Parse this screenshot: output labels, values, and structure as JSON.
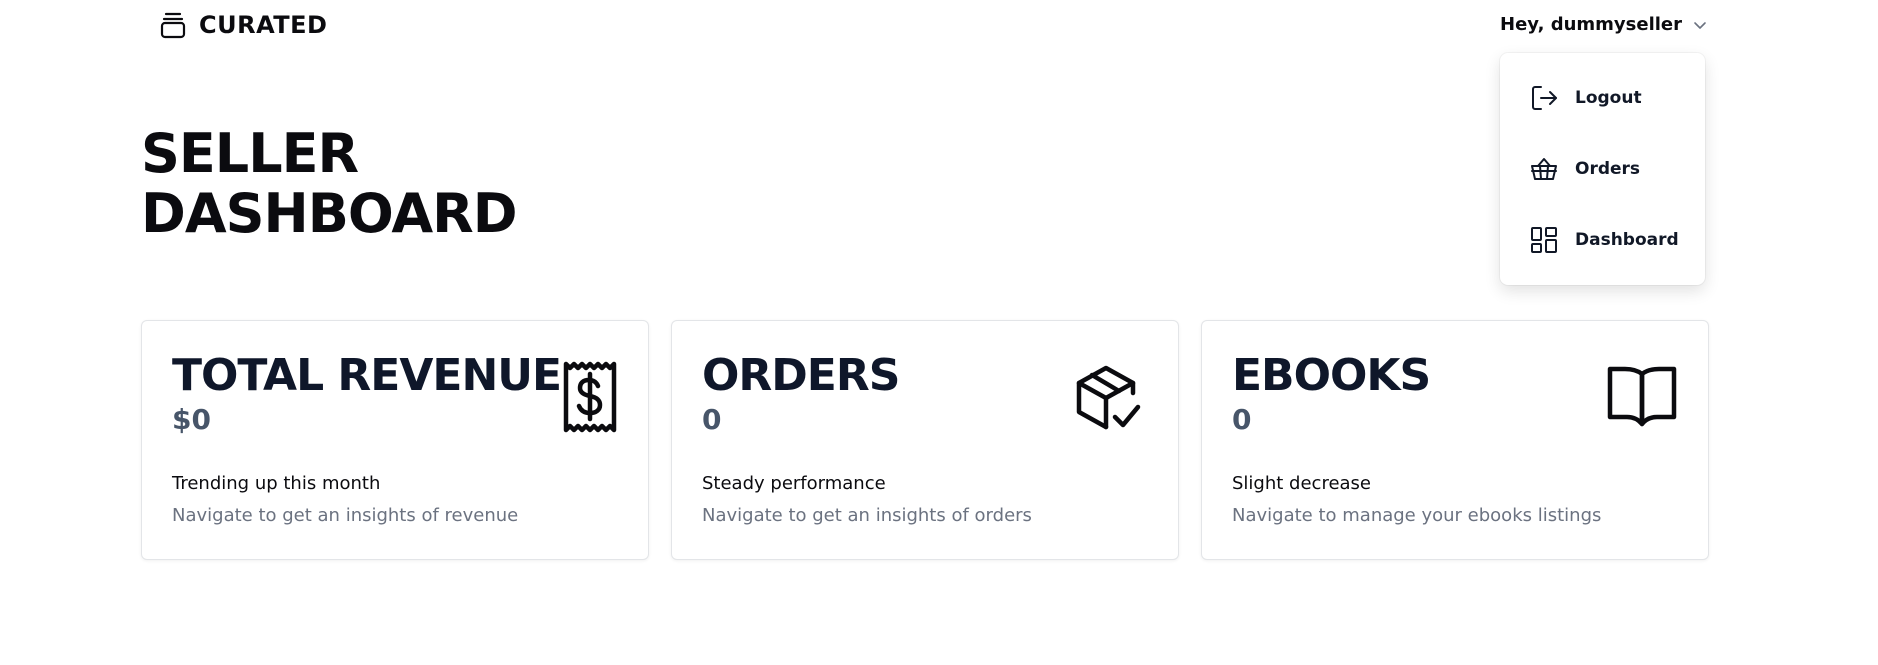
{
  "brand": {
    "name": "CURATED",
    "icon": "layers-icon"
  },
  "user_menu": {
    "greeting": "Hey, dummyseller",
    "items": [
      {
        "label": "Logout",
        "icon": "logout-icon"
      },
      {
        "label": "Orders",
        "icon": "basket-icon"
      },
      {
        "label": "Dashboard",
        "icon": "dashboard-icon"
      }
    ]
  },
  "page": {
    "title_line1": "SELLER",
    "title_line2": "DASHBOARD"
  },
  "cards": [
    {
      "title": "TOTAL REVENUE",
      "value": "$0",
      "note": "Trending up this month",
      "sub": "Navigate to get an insights of revenue",
      "icon": "receipt-dollar-icon"
    },
    {
      "title": "ORDERS",
      "value": "0",
      "note": "Steady performance",
      "sub": "Navigate to get an insights of orders",
      "icon": "package-check-icon"
    },
    {
      "title": "EBOOKS",
      "value": "0",
      "note": "Slight decrease",
      "sub": "Navigate to manage your ebooks listings",
      "icon": "book-open-icon"
    }
  ],
  "colors": {
    "text": "#0b0b0f",
    "value": "#475569",
    "muted": "#6b7280",
    "border": "#e3e5e8"
  }
}
